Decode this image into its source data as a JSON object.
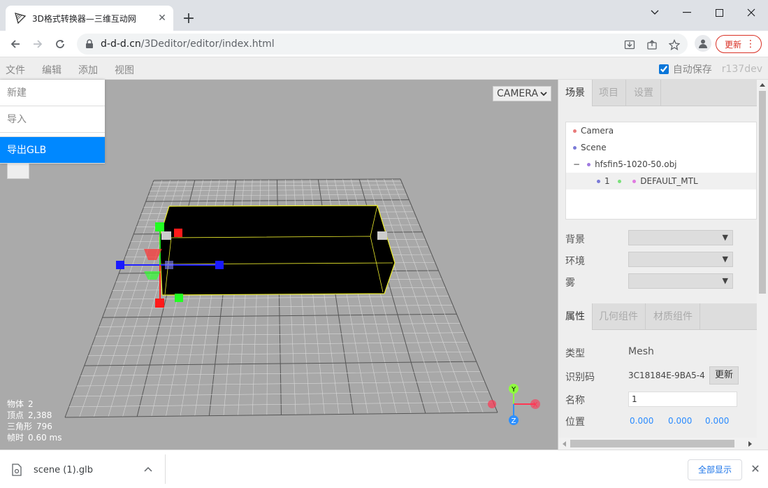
{
  "browser": {
    "tab_title": "3D格式转换器—三维互动网",
    "url_host": "d-d-d.cn",
    "url_path": "/3Deditor/editor/index.html",
    "update_label": "更新"
  },
  "menubar": {
    "items": [
      "文件",
      "编辑",
      "添加",
      "视图"
    ],
    "autosave_label": "自动保存",
    "autosave_checked": true,
    "version": "r137dev"
  },
  "file_menu": {
    "items": [
      "新建",
      "导入",
      "导出GLB"
    ],
    "active_index": 2
  },
  "viewport": {
    "camera_label": "CAMERA",
    "info": [
      {
        "label": "物体",
        "value": "2"
      },
      {
        "label": "顶点",
        "value": "2,388"
      },
      {
        "label": "三角形",
        "value": "796"
      },
      {
        "label": "帧时",
        "value": "0.60 ms"
      }
    ],
    "axes": {
      "y": "Y",
      "x": "X",
      "z": "Z"
    }
  },
  "sidebar": {
    "top_tabs": [
      "场景",
      "项目",
      "设置"
    ],
    "outliner": [
      {
        "label": "Camera",
        "dot_color": "#e97a7a"
      },
      {
        "label": "Scene",
        "dot_color": "#7a7ad7"
      },
      {
        "toggle": "−",
        "label": "hfsfin5-1020-50.obj",
        "dot_color": "#a07ae0"
      },
      {
        "label": "1",
        "dot_color": "#7a7ad7",
        "mat_dot1": "#7ae07a",
        "mat_dot2": "#e07ae0",
        "material": "DEFAULT_MTL"
      }
    ],
    "scene_props": {
      "background_label": "背景",
      "environment_label": "环境",
      "fog_label": "雾"
    },
    "prop_tabs": [
      "属性",
      "几何组件",
      "材质组件"
    ],
    "object": {
      "type_label": "类型",
      "type_value": "Mesh",
      "uuid_label": "识别码",
      "uuid_value": "3C18184E-9BA5-4",
      "uuid_button": "更新",
      "name_label": "名称",
      "name_value": "1",
      "position_label": "位置",
      "position": [
        "0.000",
        "0.000",
        "0.000"
      ]
    }
  },
  "downloads": {
    "file_name": "scene (1).glb",
    "show_all": "全部显示"
  }
}
